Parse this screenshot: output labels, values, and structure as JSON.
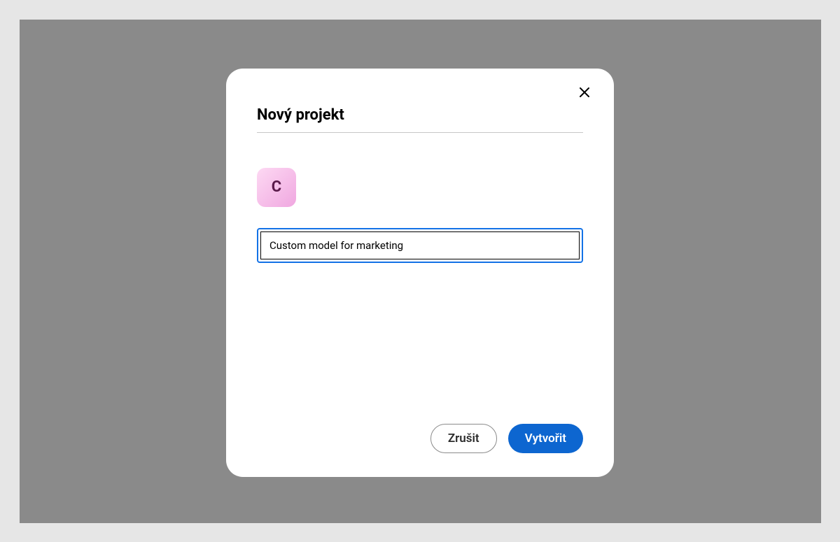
{
  "modal": {
    "title": "Nový projekt",
    "project_initial": "C",
    "name_input_value": "Custom model for marketing",
    "name_input_placeholder": "",
    "cancel_label": "Zrušit",
    "create_label": "Vytvořit"
  }
}
